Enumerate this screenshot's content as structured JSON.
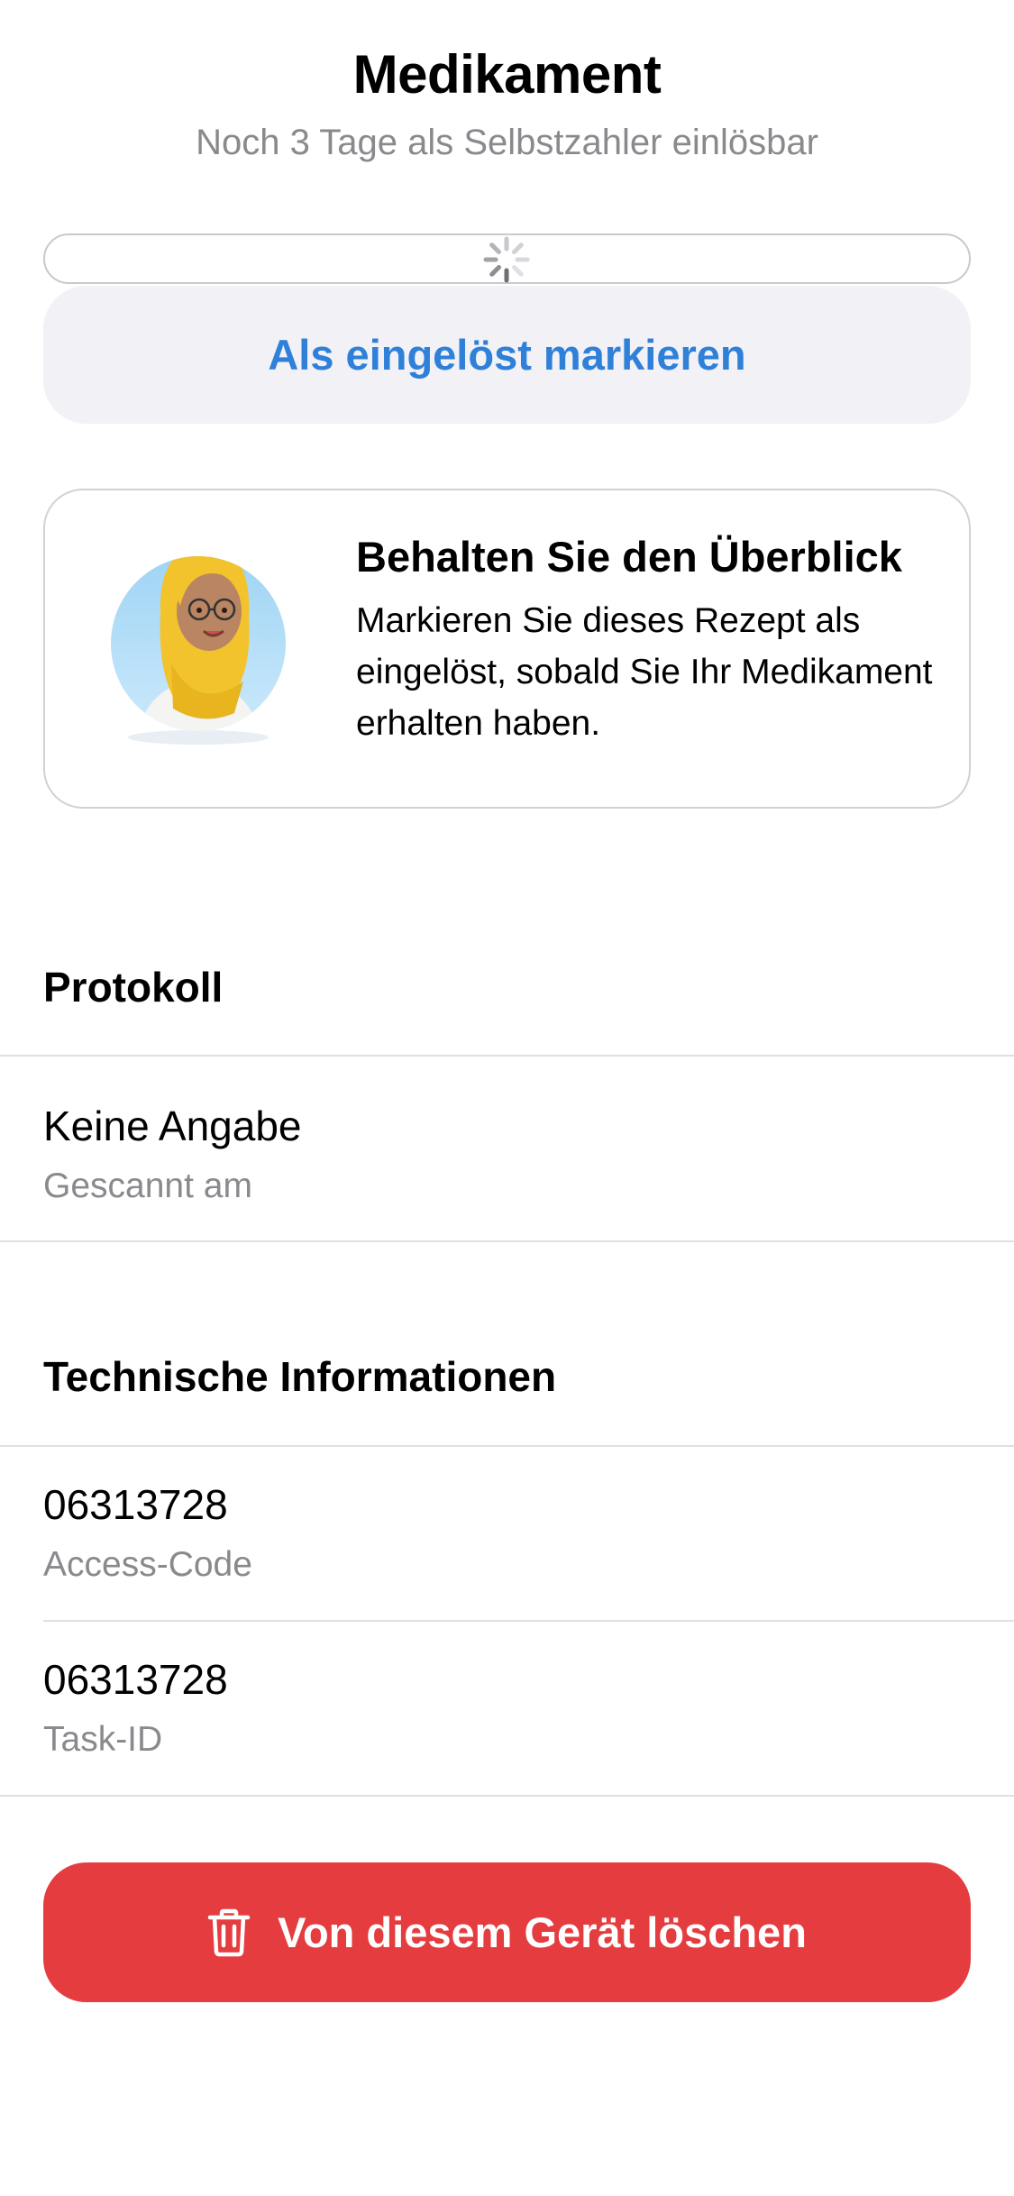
{
  "header": {
    "title": "Medikament",
    "subtitle": "Noch 3 Tage als Selbstzahler einlösbar"
  },
  "loading": {
    "icon": "activity-spinner-icon"
  },
  "actions": {
    "mark_redeemed_label": "Als eingelöst markieren",
    "delete_label": "Von diesem Gerät löschen",
    "delete_icon": "trash-icon"
  },
  "info_card": {
    "title": "Behalten Sie den Überblick",
    "text": "Markieren Sie dieses Rezept als eingelöst, sobald Sie Ihr Medikament erhalten haben.",
    "illustration": "pharmacist-avatar"
  },
  "protocol": {
    "heading": "Protokoll",
    "rows": [
      {
        "value": "Keine Angabe",
        "label": "Gescannt am"
      }
    ]
  },
  "technical": {
    "heading": "Technische Informationen",
    "rows": [
      {
        "value": "06313728",
        "label": "Access-Code"
      },
      {
        "value": "06313728",
        "label": "Task-ID"
      }
    ]
  },
  "colors": {
    "accent_blue": "#2f80d8",
    "destructive_red": "#e53c3f",
    "secondary_text": "#8a8a8e",
    "button_fill": "#f1f1f6"
  }
}
